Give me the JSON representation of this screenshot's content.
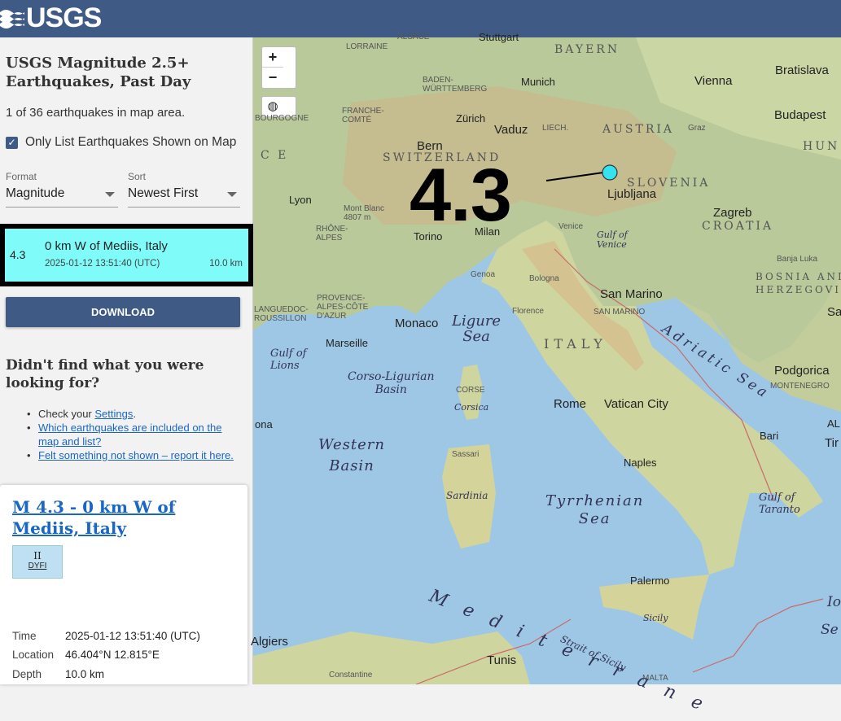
{
  "header": {
    "logo_text": "USGS"
  },
  "sidebar": {
    "title": "USGS Magnitude 2.5+ Earthquakes, Past Day",
    "count_text": "1 of 36 earthquakes in map area.",
    "only_list_label": "Only List Earthquakes Shown on Map",
    "only_list_checked": true,
    "format_label": "Format",
    "format_value": "Magnitude",
    "sort_label": "Sort",
    "sort_value": "Newest First",
    "download_label": "DOWNLOAD",
    "not_found_heading": "Didn't find what you were looking for?",
    "help_check_prefix": "Check your ",
    "help_settings_link": "Settings",
    "help_settings_suffix": ".",
    "help_link_2": "Which earthquakes are included on the map and list?",
    "help_link_3": "Felt something not shown – report it here."
  },
  "earthquake_list": [
    {
      "mag": "4.3",
      "place": "0 km W of Mediis, Italy",
      "time": "2025-01-12 13:51:40 (UTC)",
      "depth": "10.0 km",
      "highlight_color": "#7ffcfa"
    }
  ],
  "detail": {
    "title": "M 4.3 - 0 km W of Mediis, Italy",
    "dyfi_intensity": "II",
    "dyfi_label": "DYFI",
    "time_label": "Time",
    "time_value": "2025-01-12 13:51:40 (UTC)",
    "location_label": "Location",
    "location_value": "46.404°N 12.815°E",
    "depth_label": "Depth",
    "depth_value": "10.0 km"
  },
  "map": {
    "zoom_in": "+",
    "zoom_out": "−",
    "magnitude_label": "4.3",
    "marker_color": "#33e3f0",
    "labels": {
      "stuttgart": "Stuttgart",
      "lorraine": "LORRAINE",
      "alsace": "ALSACE",
      "bayern": "BAYERN",
      "bratislava": "Bratislava",
      "vienna": "Vienna",
      "baden": "BADEN-\nWÜRTTEMBERG",
      "munich": "Munich",
      "budapest": "Budapest",
      "bourgogne": "BOURGOGNE",
      "franche": "FRANCHE-\nCOMTÉ",
      "zurich": "Zürich",
      "vaduz": "Vaduz",
      "liech": "LIECH.",
      "austria": "AUSTRIA",
      "graz": "Graz",
      "hun": "HUN",
      "bern": "Bern",
      "switzerland": "SWITZERLAND",
      "slovenia": "SLOVENIA",
      "ljubljana": "Ljubljana",
      "lyon": "Lyon",
      "montblanc": "Mont Blanc\n4807 m",
      "rhone": "RHÔNE-\nALPES",
      "torino": "Torino",
      "milan": "Milan",
      "venice": "Venice",
      "gulfvenice": "Gulf of\nVenice",
      "zagreb": "Zagreb",
      "croatia": "CROATIA",
      "banjaluka": "Banja Luka",
      "bosnia": "BOSNIA AND\nHERZEGOVINA",
      "genoa": "Genoa",
      "bologna": "Bologna",
      "sanmarino": "San Marino",
      "sanmarino2": "SAN MARINO",
      "provence": "PROVENCE-\nALPES-CÔTE\nD'AZUR",
      "languedoc": "LANGUEDOC-\nROUSSILLON",
      "monaco": "Monaco",
      "ligure": "Ligure\nSea",
      "florence": "Florence",
      "italy": "ITALY",
      "adriatic": "Adriatic Sea",
      "sar": "Sar",
      "marseille": "Marseille",
      "gulflions": "Gulf of\nLions",
      "corso": "Corso-Ligurian\nBasin",
      "corse": "CORSE",
      "corsica": "Corsica",
      "podgorica": "Podgorica",
      "montenegro": "MONTENEGRO",
      "rome": "Rome",
      "vatican": "Vatican City",
      "al": "AL",
      "tir": "Tir",
      "ona": "ona",
      "bari": "Bari",
      "western": "Western\nBasin",
      "sassari": "Sassari",
      "naples": "Naples",
      "sardinia": "Sardinia",
      "gulftaranto": "Gulf of\nTaranto",
      "tyrrhenian": "Tyrrhenian\nSea",
      "palermo": "Palermo",
      "ioni": "Ioni",
      "se": "Se",
      "mediterranean": "Mediterrane",
      "sicily": "Sicily",
      "algiers": "Algiers",
      "tunis": "Tunis",
      "straitsicily": "Strait of Sicily",
      "constantine": "Constantine",
      "malta": "MALTA",
      "ce": "C E"
    }
  }
}
